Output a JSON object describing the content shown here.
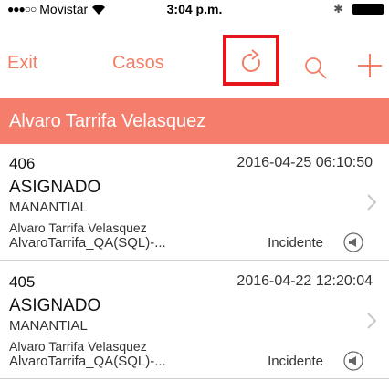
{
  "status_bar": {
    "signal_dots": "●●●○○",
    "carrier": "Movistar",
    "time": "3:04 p.m.",
    "bluetooth_glyph": "✱"
  },
  "nav": {
    "exit_label": "Exit",
    "title": "Casos",
    "accent_color": "#f47d65",
    "highlight_color": "#e4161b"
  },
  "user": {
    "name": "Alvaro Tarrifa Velasquez",
    "banner_color": "#f47e6b"
  },
  "cases": [
    {
      "number": "406",
      "datetime": "2016-04-25 06:10:50",
      "status": "ASIGNADO",
      "place": "MANANTIAL",
      "person": "Alvaro Tarrifa Velasquez",
      "reference": "AlvaroTarrifa_QA(SQL)-...",
      "type": "Incidente"
    },
    {
      "number": "405",
      "datetime": "2016-04-22 12:20:04",
      "status": "ASIGNADO",
      "place": "MANANTIAL",
      "person": "Alvaro Tarrifa Velasquez",
      "reference": "AlvaroTarrifa_QA(SQL)-...",
      "type": "Incidente"
    }
  ]
}
